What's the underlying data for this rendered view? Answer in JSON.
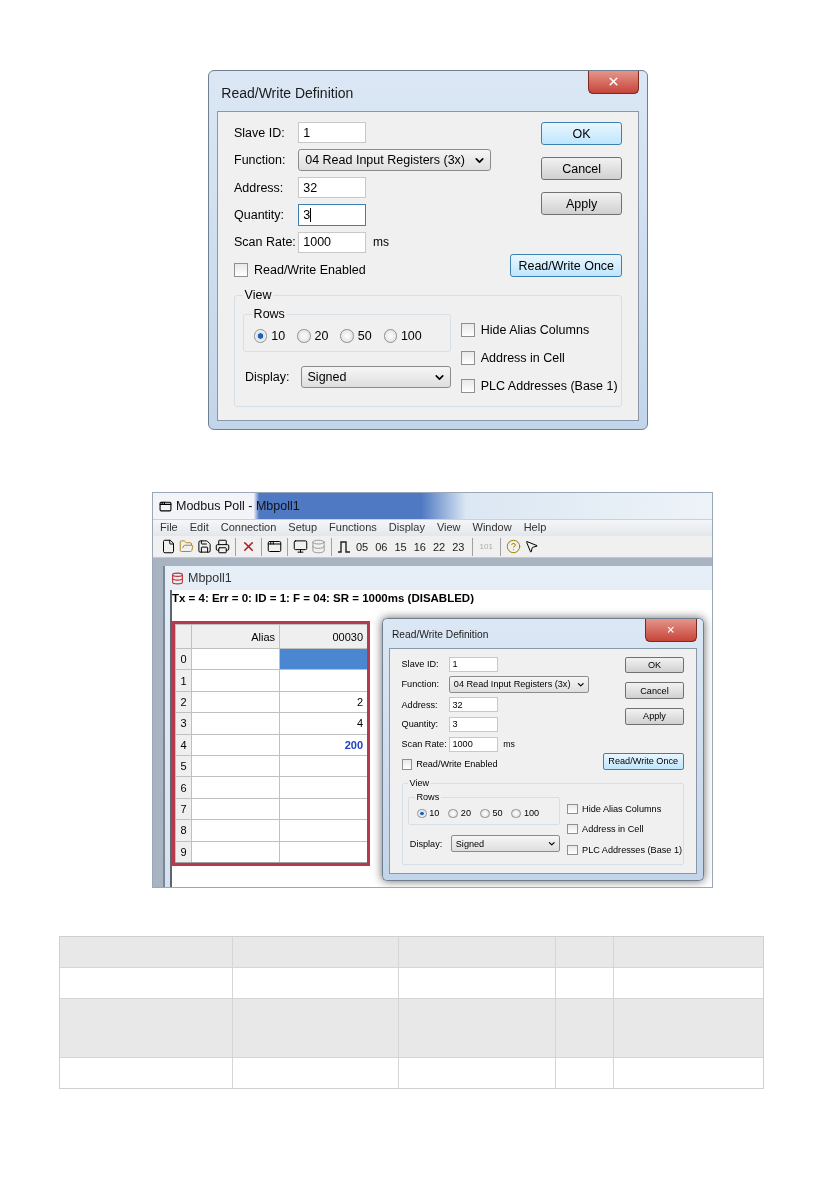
{
  "dialog_top": {
    "title": "Read/Write Definition",
    "fields": [
      {
        "label": "Slave ID:",
        "kind": "text",
        "value": "1"
      },
      {
        "label": "Function:",
        "kind": "select",
        "value": "04 Read Input Registers (3x)"
      },
      {
        "label": "Address:",
        "kind": "text",
        "value": "32"
      },
      {
        "label": "Quantity:",
        "kind": "text",
        "value": "3",
        "focused": true
      },
      {
        "label": "Scan Rate:",
        "kind": "text",
        "value": "1000",
        "unit": "ms"
      }
    ],
    "enable_checkbox": {
      "label": "Read/Write Enabled",
      "checked": false
    },
    "buttons": [
      {
        "label": "OK",
        "default": true
      },
      {
        "label": "Cancel",
        "default": false
      },
      {
        "label": "Apply",
        "default": false
      }
    ],
    "once_button": {
      "label": "Read/Write Once",
      "highlighted": true
    },
    "view": {
      "legend": "View",
      "rows_legend": "Rows",
      "rows_options": [
        {
          "label": "10",
          "selected": true
        },
        {
          "label": "20",
          "selected": false
        },
        {
          "label": "50",
          "selected": false
        },
        {
          "label": "100",
          "selected": false
        }
      ],
      "display_label": "Display:",
      "display_value": "Signed",
      "options": [
        {
          "label": "Hide Alias Columns",
          "checked": false
        },
        {
          "label": "Address in Cell",
          "checked": false
        },
        {
          "label": "PLC Addresses (Base 1)",
          "checked": false
        }
      ]
    }
  },
  "main_window": {
    "title": "Modbus Poll - Mbpoll1",
    "menu": [
      "File",
      "Edit",
      "Connection",
      "Setup",
      "Functions",
      "Display",
      "View",
      "Window",
      "Help"
    ],
    "toolbar": [
      {
        "kind": "new"
      },
      {
        "kind": "open"
      },
      {
        "kind": "save"
      },
      {
        "kind": "print"
      },
      {
        "kind": "sep"
      },
      {
        "kind": "delete"
      },
      {
        "kind": "sep"
      },
      {
        "kind": "window"
      },
      {
        "kind": "sep"
      },
      {
        "kind": "connect"
      },
      {
        "kind": "disconnect"
      },
      {
        "kind": "sep"
      },
      {
        "kind": "pulse"
      },
      {
        "kind": "text",
        "label": "05",
        "disabled": false
      },
      {
        "kind": "text",
        "label": "06",
        "disabled": false
      },
      {
        "kind": "text",
        "label": "15",
        "disabled": false
      },
      {
        "kind": "text",
        "label": "16",
        "disabled": false
      },
      {
        "kind": "text",
        "label": "22",
        "disabled": false
      },
      {
        "kind": "text",
        "label": "23",
        "disabled": false
      },
      {
        "kind": "sep"
      },
      {
        "kind": "text",
        "label": "101",
        "disabled": true
      },
      {
        "kind": "sep"
      },
      {
        "kind": "help"
      },
      {
        "kind": "context_help"
      }
    ],
    "child": {
      "title": "Mbpoll1",
      "status": "Tx = 4: Err = 0: ID = 1: F = 04: SR = 1000ms  (DISABLED)",
      "columns": [
        "Alias",
        "00030"
      ],
      "rows": [
        {
          "index": "0",
          "selected": true
        },
        {
          "index": "1",
          "selected": false
        },
        {
          "index": "2",
          "value": "2",
          "selected": false
        },
        {
          "index": "3",
          "value": "4",
          "selected": false
        },
        {
          "index": "4",
          "value": "200",
          "color": "#2040c0",
          "selected": false
        },
        {
          "index": "5",
          "selected": false
        },
        {
          "index": "6",
          "selected": false
        },
        {
          "index": "7",
          "selected": false
        },
        {
          "index": "8",
          "selected": false
        },
        {
          "index": "9",
          "selected": false
        }
      ]
    },
    "dialog": {
      "title": "Read/Write Definition",
      "fields": [
        {
          "label": "Slave ID:",
          "kind": "text",
          "value": "1"
        },
        {
          "label": "Function:",
          "kind": "select",
          "value": "04 Read Input Registers (3x)"
        },
        {
          "label": "Address:",
          "kind": "text",
          "value": "32"
        },
        {
          "label": "Quantity:",
          "kind": "text",
          "value": "3"
        },
        {
          "label": "Scan Rate:",
          "kind": "text",
          "value": "1000",
          "unit": "ms"
        }
      ],
      "enable_checkbox": {
        "label": "Read/Write Enabled",
        "checked": false
      },
      "buttons": [
        {
          "label": "OK",
          "default": false
        },
        {
          "label": "Cancel",
          "default": false
        },
        {
          "label": "Apply",
          "default": false
        }
      ],
      "once_button": {
        "label": "Read/Write Once",
        "highlighted": true
      },
      "view": {
        "legend": "View",
        "rows_legend": "Rows",
        "rows_options": [
          {
            "label": "10",
            "selected": true
          },
          {
            "label": "20",
            "selected": false
          },
          {
            "label": "50",
            "selected": false
          },
          {
            "label": "100",
            "selected": false
          }
        ],
        "display_label": "Display:",
        "display_value": "Signed",
        "options": [
          {
            "label": "Hide Alias Columns",
            "checked": false
          },
          {
            "label": "Address in Cell",
            "checked": false
          },
          {
            "label": "PLC Addresses (Base 1)",
            "checked": false
          }
        ]
      }
    }
  },
  "empty_table": {
    "rows": [
      {
        "kind": "shaded"
      },
      {
        "kind": "plain"
      },
      {
        "kind": "tall_shaded"
      },
      {
        "kind": "plain"
      }
    ]
  }
}
